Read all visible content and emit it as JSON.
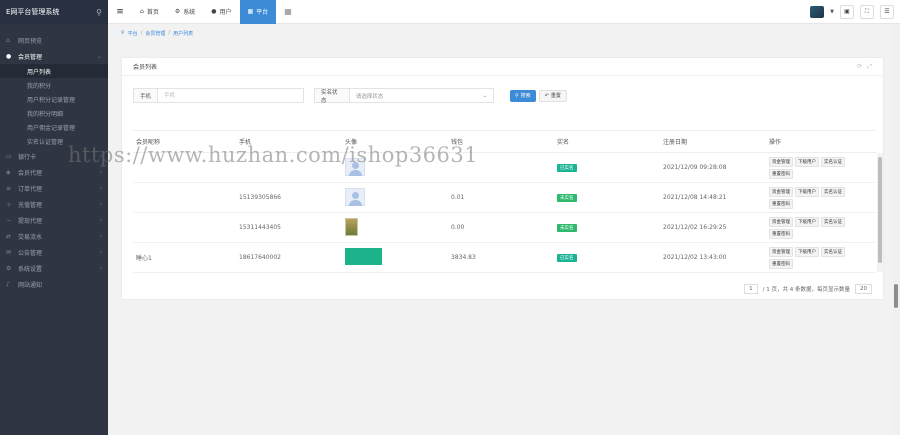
{
  "app": {
    "title": "E网平台管理系统"
  },
  "sidebar": {
    "items": [
      {
        "label": "网页预览",
        "icon": "home-icon"
      },
      {
        "label": "会员管理",
        "icon": "user-icon",
        "active": true,
        "children": [
          {
            "label": "用户列表",
            "active": true
          },
          {
            "label": "我的积分"
          },
          {
            "label": "用户积分记录管理"
          },
          {
            "label": "我的积分明细"
          },
          {
            "label": "用户佣金记录管理"
          },
          {
            "label": "实名认证管理"
          }
        ]
      },
      {
        "label": "银行卡",
        "icon": "card-icon"
      },
      {
        "label": "会员代理",
        "icon": "agent-icon"
      },
      {
        "label": "订单代理",
        "icon": "order-icon"
      },
      {
        "label": "充值管理",
        "icon": "recharge-icon"
      },
      {
        "label": "提现代理",
        "icon": "withdraw-icon"
      },
      {
        "label": "交易流水",
        "icon": "flow-icon"
      },
      {
        "label": "公告管理",
        "icon": "notice-icon"
      },
      {
        "label": "系统设置",
        "icon": "settings-icon"
      },
      {
        "label": "网站通知",
        "icon": "bell-icon"
      }
    ]
  },
  "topbar": {
    "tabs": [
      {
        "label": "首页",
        "icon": "home"
      },
      {
        "label": "系统",
        "icon": "gear"
      },
      {
        "label": "用户",
        "icon": "user"
      },
      {
        "label": "平台",
        "icon": "grid",
        "active": true
      }
    ]
  },
  "breadcrumb": [
    "平台",
    "会员管理",
    "用户列表"
  ],
  "card": {
    "title": "会员列表"
  },
  "filters": {
    "phone_label": "手机",
    "phone_placeholder": "手机",
    "status_label": "实名状态",
    "status_placeholder": "请选择状态",
    "search_label": "搜索",
    "reset_label": "重置"
  },
  "table": {
    "columns": [
      "会员昵称",
      "手机",
      "头像",
      "钱包",
      "实名",
      "注册日期",
      "操作"
    ],
    "rows": [
      {
        "nickname": "",
        "phone": "",
        "avatar": "user",
        "wallet": "",
        "status": "已实名",
        "status_type": "done",
        "date": "2021/12/09 09:28:08",
        "ops": [
          "资金管理",
          "下级用户",
          "实名认证",
          "重置密码"
        ]
      },
      {
        "nickname": "",
        "phone": "15139305866",
        "avatar": "user",
        "wallet": "0.01",
        "status": "未实名",
        "status_type": "pending",
        "date": "2021/12/08 14:48:21",
        "ops": [
          "资金管理",
          "下级用户",
          "实名认证",
          "重置密码"
        ]
      },
      {
        "nickname": "",
        "phone": "15311443405",
        "avatar": "photo",
        "wallet": "0.00",
        "status": "未实名",
        "status_type": "pending",
        "date": "2021/12/02 16:29:25",
        "ops": [
          "资金管理",
          "下级用户",
          "实名认证",
          "重置密码"
        ]
      },
      {
        "nickname": "睡心1",
        "phone": "18617640002",
        "avatar": "green",
        "wallet": "3834.83",
        "status": "已实名",
        "status_type": "done",
        "date": "2021/12/02 13:43:00",
        "ops": [
          "资金管理",
          "下级用户",
          "实名认证",
          "重置密码"
        ]
      }
    ]
  },
  "pager": {
    "page": "1",
    "summary": "/ 1 页，共 4 条数据，每页显示数量",
    "size": "20"
  },
  "watermark": "https://www.huzhan.com/ishop36631"
}
